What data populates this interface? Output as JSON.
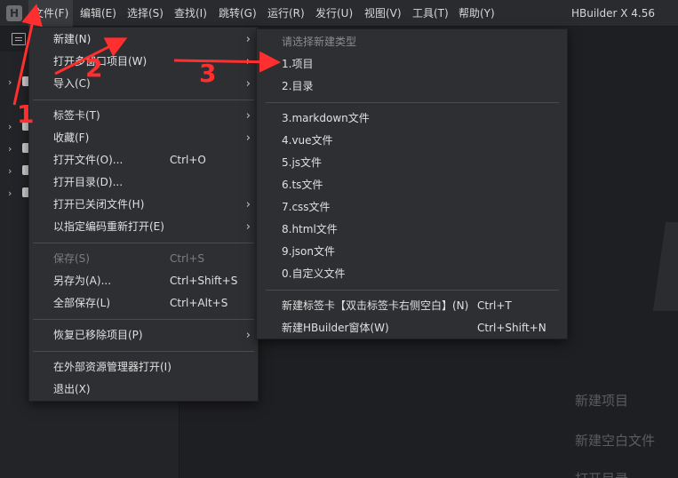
{
  "menubar": {
    "logo": "H",
    "items": [
      {
        "label": "文件(F)",
        "active": true
      },
      {
        "label": "编辑(E)"
      },
      {
        "label": "选择(S)"
      },
      {
        "label": "查找(I)"
      },
      {
        "label": "跳转(G)"
      },
      {
        "label": "运行(R)"
      },
      {
        "label": "发行(U)"
      },
      {
        "label": "视图(V)"
      },
      {
        "label": "工具(T)"
      },
      {
        "label": "帮助(Y)"
      }
    ],
    "app_title": "HBuilder X 4.56"
  },
  "file_menu": {
    "items": [
      {
        "label": "新建(N)",
        "shortcut": "",
        "submenu": true
      },
      {
        "label": "打开多窗口项目(W)",
        "shortcut": "",
        "submenu": true
      },
      {
        "label": "导入(C)",
        "shortcut": "",
        "submenu": true
      },
      {
        "label": "标签卡(T)",
        "shortcut": "",
        "submenu": true
      },
      {
        "label": "收藏(F)",
        "shortcut": "",
        "submenu": true
      },
      {
        "label": "打开文件(O)...",
        "shortcut": "Ctrl+O"
      },
      {
        "label": "打开目录(D)...",
        "shortcut": ""
      },
      {
        "label": "打开已关闭文件(H)",
        "shortcut": "",
        "submenu": true
      },
      {
        "label": "以指定编码重新打开(E)",
        "shortcut": "",
        "submenu": true
      },
      {
        "label": "保存(S)",
        "shortcut": "Ctrl+S",
        "disabled": true
      },
      {
        "label": "另存为(A)...",
        "shortcut": "Ctrl+Shift+S"
      },
      {
        "label": "全部保存(L)",
        "shortcut": "Ctrl+Alt+S"
      },
      {
        "label": "恢复已移除项目(P)",
        "shortcut": "",
        "submenu": true
      },
      {
        "label": "在外部资源管理器打开(I)",
        "shortcut": ""
      },
      {
        "label": "退出(X)",
        "shortcut": ""
      }
    ]
  },
  "new_submenu": {
    "header": "请选择新建类型",
    "items": [
      {
        "label": "1.项目",
        "shortcut": ""
      },
      {
        "label": "2.目录",
        "shortcut": ""
      },
      {
        "label": "3.markdown文件",
        "shortcut": ""
      },
      {
        "label": "4.vue文件",
        "shortcut": ""
      },
      {
        "label": "5.js文件",
        "shortcut": ""
      },
      {
        "label": "6.ts文件",
        "shortcut": ""
      },
      {
        "label": "7.css文件",
        "shortcut": ""
      },
      {
        "label": "8.html文件",
        "shortcut": ""
      },
      {
        "label": "9.json文件",
        "shortcut": ""
      },
      {
        "label": "0.自定义文件",
        "shortcut": ""
      },
      {
        "label": "新建标签卡【双击标签卡右侧空白】(N)",
        "shortcut": "Ctrl+T"
      },
      {
        "label": "新建HBuilder窗体(W)",
        "shortcut": "Ctrl+Shift+N"
      }
    ]
  },
  "welcome": {
    "new_project": "新建项目",
    "new_blank_file": "新建空白文件",
    "open_dir": "打开目录"
  },
  "annotations": {
    "step1": "1",
    "step2": "2",
    "step3": "3",
    "color": "#ff2f2f"
  },
  "colors": {
    "menubar_bg": "#2a2b2e",
    "menu_bg": "#2e2f33",
    "sidebar_bg": "#232427",
    "editor_bg": "#1e1f22"
  }
}
